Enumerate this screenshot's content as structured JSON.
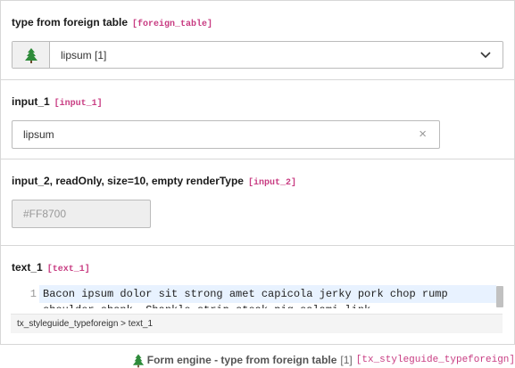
{
  "section1": {
    "label": "type from foreign table",
    "code": "[foreign_table]",
    "select_value": "lipsum [1]",
    "icon": "tree-icon"
  },
  "section2": {
    "label": "input_1",
    "code": "[input_1]",
    "value": "lipsum",
    "clear_symbol": "×"
  },
  "section3": {
    "label": "input_2, readOnly, size=10, empty renderType",
    "code": "[input_2]",
    "placeholder": "#FF8700"
  },
  "section4": {
    "label": "text_1",
    "code": "[text_1]",
    "line_number": "1",
    "code_text": "Bacon ipsum dolor sit strong amet capicola jerky pork chop rump\nshoulder shank. Shankle strip steak pig salami link",
    "breadcrumb": "tx_styleguide_typeforeign > text_1"
  },
  "footer": {
    "title": "Form engine - type from foreign table",
    "count": "[1]",
    "code": "[tx_styleguide_typeforeign]",
    "icon": "tree-icon"
  },
  "colors": {
    "accent_code": "#c83c82",
    "tree_green": "#2e8b3a",
    "highlight": "#e8f2ff"
  }
}
